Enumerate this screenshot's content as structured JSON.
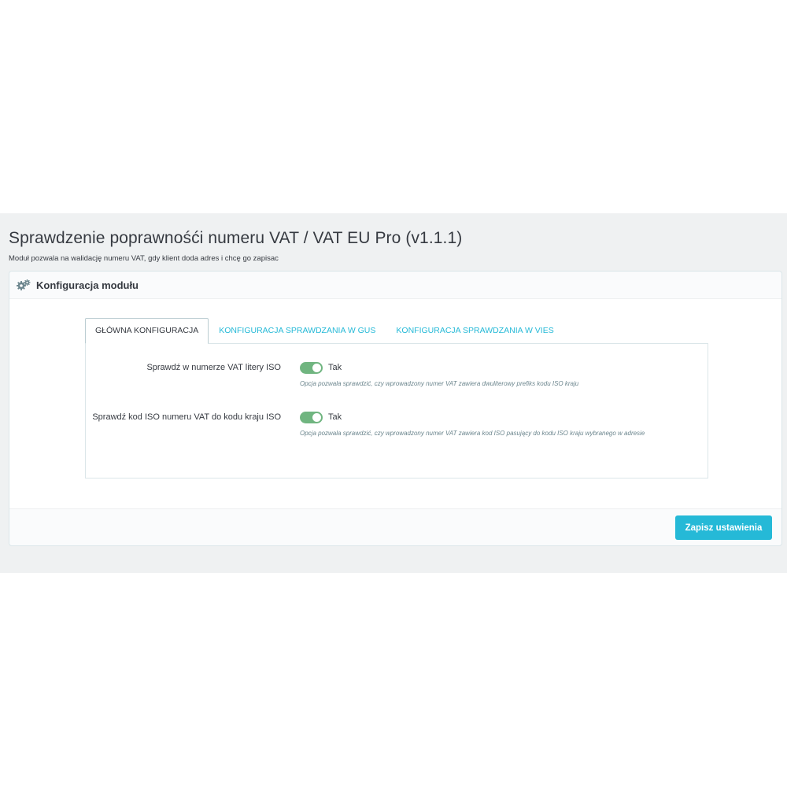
{
  "header": {
    "title": "Sprawdzenie poprawnośći numeru VAT / VAT EU Pro (v1.1.1)",
    "subtitle": "Moduł pozwala na walidację numeru VAT, gdy klient doda adres i chcę go zapisac"
  },
  "panel": {
    "title": "Konfiguracja modułu",
    "icon": "cogs-icon"
  },
  "tabs": [
    {
      "label": "GŁÓWNA KONFIGURACJA",
      "active": true
    },
    {
      "label": "KONFIGURACJA SPRAWDZANIA W GUS",
      "active": false
    },
    {
      "label": "KONFIGURACJA SPRAWDZANIA W VIES",
      "active": false
    }
  ],
  "fields": [
    {
      "label": "Sprawdź w numerze VAT litery ISO",
      "state": "Tak",
      "enabled": true,
      "help": "Opcja pozwala sprawdzić, czy wprowadzony numer VAT zawiera dwuliterowy prefiks kodu ISO kraju"
    },
    {
      "label": "Sprawdź kod ISO numeru VAT do kodu kraju ISO",
      "state": "Tak",
      "enabled": true,
      "help": "Opcja pozwala sprawdzić, czy wprowadzony numer VAT zawiera kod ISO pasujący do kodu ISO kraju wybranego w adresie"
    }
  ],
  "footer": {
    "save_label": "Zapisz ustawienia"
  },
  "colors": {
    "accent": "#25b9d7",
    "switch_on": "#70b580",
    "background": "#eff1f2"
  }
}
